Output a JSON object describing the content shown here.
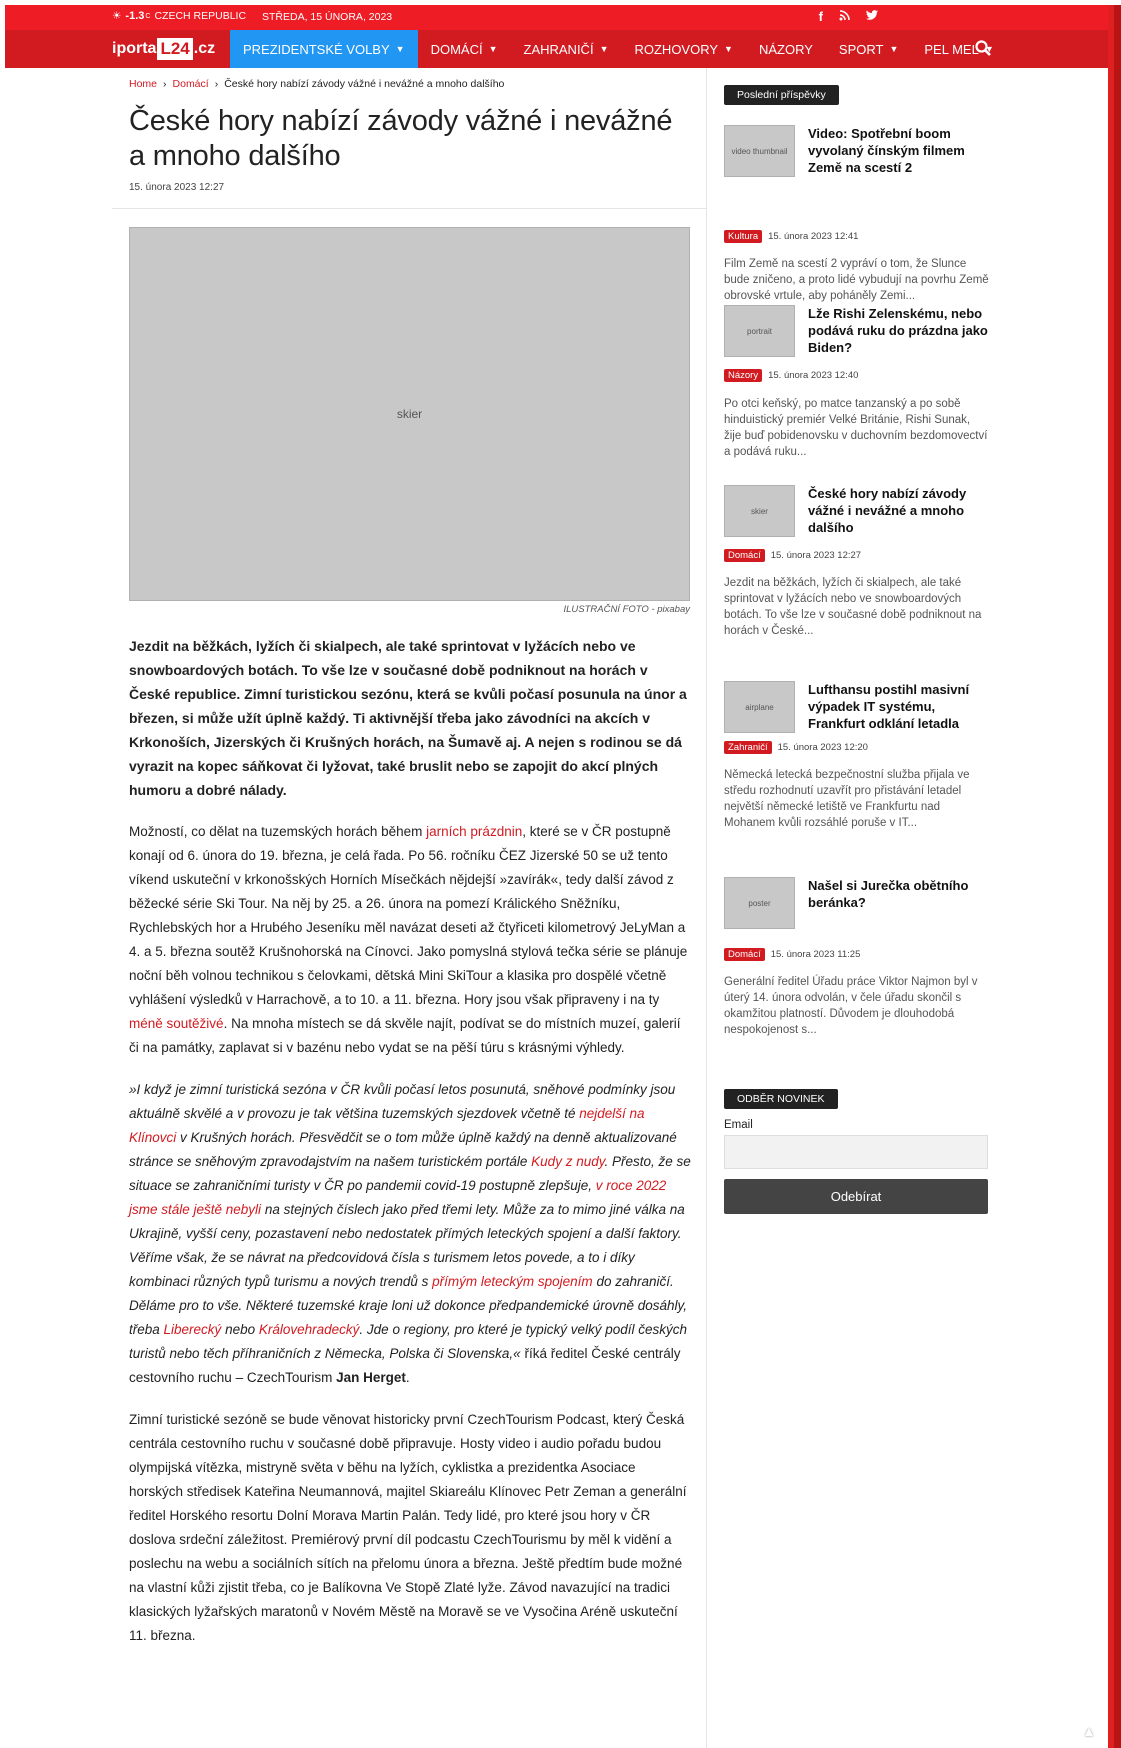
{
  "topbar": {
    "temp": "-1.3",
    "temp_unit": "C",
    "location": "CZECH REPUBLIC",
    "date": "STŘEDA, 15 ÚNORA, 2023",
    "social": [
      "facebook-icon",
      "rss-icon",
      "twitter-icon"
    ]
  },
  "nav": {
    "logo_pre": "iporta",
    "logo_box": "L24",
    "logo_post": ".cz",
    "items": [
      {
        "label": "PREZIDENTSKÉ VOLBY",
        "dropdown": true,
        "active": true
      },
      {
        "label": "DOMÁCÍ",
        "dropdown": true
      },
      {
        "label": "ZAHRANIČÍ",
        "dropdown": true
      },
      {
        "label": "ROZHOVORY",
        "dropdown": true
      },
      {
        "label": "NÁZORY",
        "dropdown": false
      },
      {
        "label": "SPORT",
        "dropdown": true
      },
      {
        "label": "PEL MEL",
        "dropdown": true
      }
    ],
    "accent": "#d11b21",
    "active_color": "#2196f3"
  },
  "breadcrumb": {
    "home": "Home",
    "section": "Domácí",
    "current": "České hory nabízí závody vážné i nevážné a mnoho dalšího"
  },
  "article": {
    "title": "České hory nabízí závody vážné i nevážné a mnoho dalšího",
    "date": "15. února 2023 12:27",
    "image_alt": "skier",
    "caption": "ILUSTRAČNÍ FOTO - pixabay",
    "lead": "Jezdit na běžkách, lyžích či skialpech, ale také sprintovat v lyžácích nebo ve snowboardových botách. To vše lze v současné době podniknout na horách v České republice. Zimní turistickou sezónu, která se kvůli počasí posunula na únor a březen, si může užít úplně každý. Ti aktivnější třeba jako závodníci na akcích v Krkonoších, Jizerských či Krušných horách, na Šumavě aj. A nejen s rodinou se dá vyrazit na kopec sáňkovat či lyžovat, také bruslit nebo se zapojit do akcí plných humoru a dobré nálady.",
    "p1": {
      "t1": "Možností, co dělat na tuzemských horách během ",
      "l1": "jarních prázdnin",
      "t2": ", které se v ČR postupně konají od 6. února do 19. března, je celá řada. Po 56. ročníku ČEZ Jizerské 50 se už tento víkend uskuteční v krkonošských Horních Mísečkách nějdejší »zavírák«, tedy další závod z běžecké série Ski Tour. Na něj by 25. a 26. února na pomezí Králického Sněžníku, Rychlebských hor a Hrubého Jeseníku měl navázat deseti až čtyřiceti kilometrový JeLyMan a 4. a 5. března soutěž Krušnohorská na Cínovci. Jako pomyslná stylová tečka série se plánuje noční běh volnou technikou s čelovkami, dětská Mini SkiTour a klasika pro dospělé včetně vyhlášení výsledků v Harrachově, a to 10. a 11. března. Hory jsou však připraveny i na ty ",
      "l2": "méně soutěživé",
      "t3": ". Na mnoha místech se dá skvěle najít, podívat se do místních muzeí, galerií či na památky, zaplavat si v bazénu nebo vydat se na pěší túru s krásnými výhledy."
    },
    "quote": {
      "t1": "»I když je zimní turistická sezóna v ČR kvůli počasí letos posunutá, sněhové podmínky jsou aktuálně skvělé a v provozu je tak většina tuzemských sjezdovek včetně té ",
      "l1": "nejdelší na Klínovci",
      "t2": " v Krušných horách. Přesvědčit se o tom může úplně každý na denně aktualizované stránce se sněhovým zpravodajstvím na našem turistickém portále ",
      "l2": "Kudy z nudy",
      "t3": ". Přesto, že se situace se zahraničními turisty v ČR po pandemii covid-19 postupně zlepšuje, ",
      "l3": "v roce 2022 jsme stále ještě nebyli",
      "t4": " na stejných číslech jako před třemi lety. Může za to mimo jiné válka na Ukrajině, vyšší ceny, pozastavení nebo nedostatek přímých leteckých spojení a další faktory. Věříme však, že se návrat na předcovidová čísla s turismem letos povede, a to i díky kombinaci různých typů turismu a nových trendů s ",
      "l4": "přímým leteckým spojením",
      "t5": " do zahraničí. Děláme pro to vše. Některé tuzemské kraje loni už dokonce předpandemické úrovně dosáhly, třeba ",
      "l5": "Liberecký",
      "t6": " nebo ",
      "l6": "Královehradecký",
      "t7": ". Jde o regiony, pro které je typický velký podíl českých turistů nebo těch příhraničních z Německa, Polska či Slovenska,«",
      "t8": " říká ředitel České centrály cestovního ruchu – CzechTourism ",
      "name": "Jan Herget",
      "end": "."
    },
    "p3": "Zimní turistické sezóně se bude věnovat historicky první CzechTourism Podcast, který Česká centrála cestovního ruchu v současné době připravuje. Hosty video i audio pořadu budou olympijská vítězka, mistryně světa v běhu na lyžích, cyklistka a prezidentka Asociace horských středisek Kateřina Neumannová, majitel Skiareálu Klínovec Petr Zeman a generální ředitel Horského resortu Dolní Morava Martin Palán. Tedy lidé, pro které jsou hory v ČR doslova srdeční záležitost. Premiérový první díl podcastu CzechTourismu by měl k vidění a poslechu na webu a sociálních sítích na přelomu února a března. Ještě předtím bude možné na vlastní kůži zjistit třeba, co je Balíkovna Ve Stopě Zlaté lyže. Závod navazující na tradici klasických lyžařských maratonů v Novém Městě na Moravě se ve Vysočina Aréně uskuteční 11. března."
  },
  "sidebar": {
    "title": "Poslední příspěvky",
    "posts": [
      {
        "thumb": "video thumbnail",
        "title": "Video: Spotřební boom vyvolaný čínským filmem Země na scestí 2",
        "cat": "Kultura",
        "date": "15. února 2023 12:41",
        "excerpt": "Film Země na scestí 2 vypráví o tom, že Slunce bude zničeno, a proto lidé vybudují na povrhu Země obrovské vrtule, aby poháněly Zemi..."
      },
      {
        "thumb": "portrait",
        "title": "Lže Rishi Zelenskému, nebo podává ruku do prázdna jako Biden?",
        "cat": "Názory",
        "date": "15. února 2023 12:40",
        "excerpt": "Po otci keňský, po matce tanzanský a po sobě hinduistický premiér Velké Británie, Rishi Sunak, žije buď pobidenovsku v duchovním bezdomovectví a podává ruku..."
      },
      {
        "thumb": "skier",
        "title": "České hory nabízí závody vážné i nevážné a mnoho dalšího",
        "cat": "Domácí",
        "date": "15. února 2023 12:27",
        "excerpt": "Jezdit na běžkách, lyžích či skialpech, ale také sprintovat v lyžácích nebo ve snowboardových botách. To vše lze v současné době podniknout na horách v České..."
      },
      {
        "thumb": "airplane",
        "title": "Lufthansu postihl masivní výpadek IT systému, Frankfurt odklání letadla",
        "cat": "Zahraničí",
        "date": "15. února 2023 12:20",
        "excerpt": "Německá letecká bezpečnostní služba přijala ve středu rozhodnutí uzavřít pro přistávání letadel největší německé letiště ve Frankfurtu nad Mohanem kvůli rozsáhlé poruše v IT..."
      },
      {
        "thumb": "poster",
        "title": "Našel si Jurečka obětního beránka?",
        "cat": "Domácí",
        "date": "15. února 2023 11:25",
        "excerpt": "Generální ředitel Úřadu práce Viktor Najmon byl v úterý 14. února odvolán, v čele úřadu skončil s okamžitou platností. Důvodem je dlouhodobá nespokojenost s..."
      }
    ]
  },
  "newsletter": {
    "title": "ODBĚR NOVINEK",
    "email_label": "Email",
    "email_value": "",
    "button": "Odebírat"
  }
}
